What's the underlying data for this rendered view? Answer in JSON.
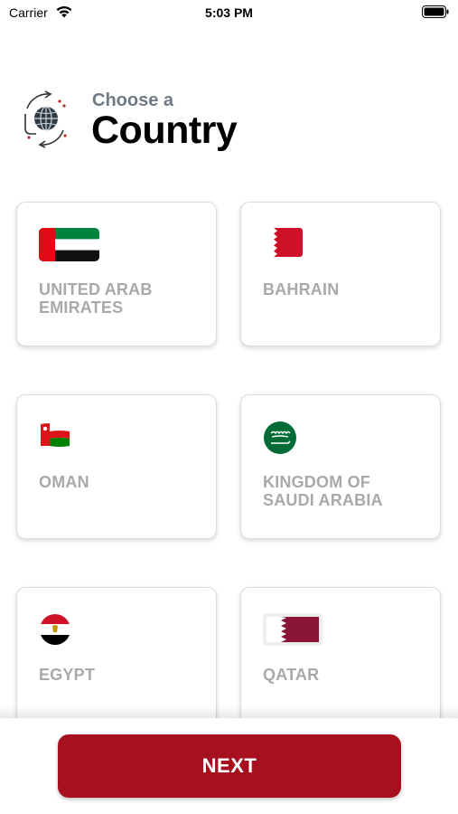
{
  "status_bar": {
    "carrier": "Carrier",
    "time": "5:03 PM"
  },
  "header": {
    "subtitle": "Choose a",
    "title": "Country",
    "icon": "globe-swap-icon"
  },
  "countries": [
    {
      "name": "UNITED ARAB EMIRATES",
      "flag": "uae-flag-icon"
    },
    {
      "name": "BAHRAIN",
      "flag": "bahrain-flag-icon"
    },
    {
      "name": "OMAN",
      "flag": "oman-flag-icon"
    },
    {
      "name": "KINGDOM OF SAUDI ARABIA",
      "flag": "saudi-flag-icon"
    },
    {
      "name": "EGYPT",
      "flag": "egypt-flag-icon"
    },
    {
      "name": "QATAR",
      "flag": "qatar-flag-icon"
    }
  ],
  "footer": {
    "next_label": "NEXT"
  },
  "colors": {
    "accent": "#a7111f",
    "subtitle": "#6f7a85",
    "card_text": "#a9a9a9"
  }
}
